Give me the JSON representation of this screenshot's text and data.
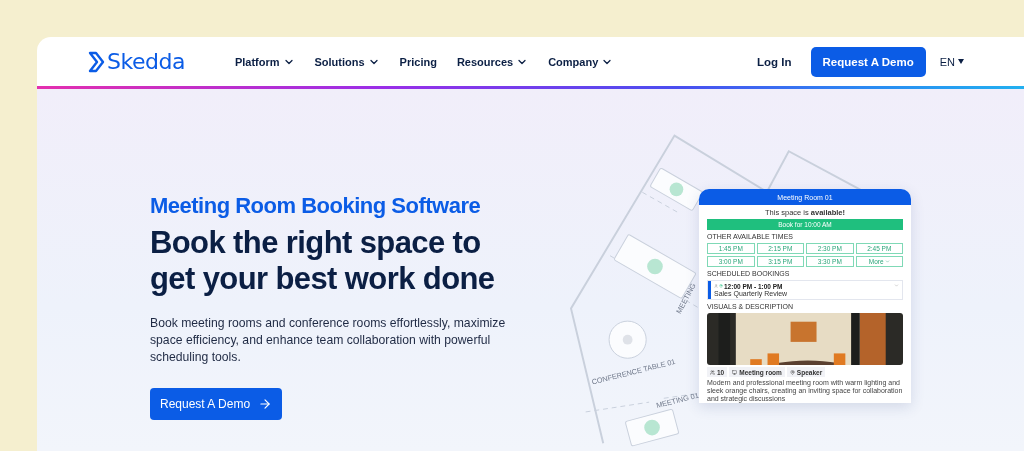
{
  "nav": {
    "logo": "Skedda",
    "items": [
      {
        "label": "Platform",
        "dropdown": true
      },
      {
        "label": "Solutions",
        "dropdown": true
      },
      {
        "label": "Pricing",
        "dropdown": false
      },
      {
        "label": "Resources",
        "dropdown": true
      },
      {
        "label": "Company",
        "dropdown": true
      }
    ],
    "login": "Log In",
    "cta": "Request A Demo",
    "language": "EN"
  },
  "hero": {
    "eyebrow": "Meeting Room Booking Software",
    "heading": "Book the right space to get your best work done",
    "body": "Book meeting rooms and conference rooms effortlessly, maximize space efficiency, and enhance team collaboration with powerful scheduling tools.",
    "cta": "Request A Demo"
  },
  "floor_plan": {
    "labels": [
      {
        "text": "CONFERENCE TABLE 01"
      },
      {
        "text": "MEETING 01"
      },
      {
        "text": "MEETING"
      }
    ]
  },
  "booking_card": {
    "title": "Meeting Room 01",
    "status": "This space is **available!**",
    "book_button": "Book for 10:00 AM",
    "other_times_label": "OTHER AVAILABLE TIMES",
    "times": [
      {
        "label": "1:45 PM",
        "kind": "time"
      },
      {
        "label": "2:15 PM",
        "kind": "time"
      },
      {
        "label": "2:30 PM",
        "kind": "time"
      },
      {
        "label": "2:45 PM",
        "kind": "time"
      },
      {
        "label": "3:00 PM",
        "kind": "time"
      },
      {
        "label": "3:15 PM",
        "kind": "time"
      },
      {
        "label": "3:30 PM",
        "kind": "time"
      },
      {
        "label": "More",
        "kind": "more"
      }
    ],
    "scheduled_label": "SCHEDULED BOOKINGS",
    "bookings": [
      {
        "time": "12:00 PM - 1:00 PM",
        "title": "Sales Quarterly Review",
        "color": "#0b5ce6"
      }
    ],
    "visuals_label": "VISUALS & DESCRIPTION",
    "features": [
      {
        "kind": "capacity",
        "label": "10"
      },
      {
        "kind": "room",
        "label": "Meeting room"
      },
      {
        "kind": "equipment",
        "label": "Speaker"
      }
    ],
    "description": "Modern and professional meeting room with warm lighting and sleek orange chairs, creating an inviting space for collaboration and strategic discussions"
  }
}
